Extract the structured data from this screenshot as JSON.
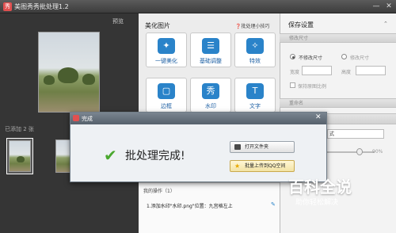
{
  "window": {
    "title": "美图秀秀批处理1.2",
    "icon_glyph": "秀",
    "controls": [
      "—",
      "✕"
    ]
  },
  "left": {
    "preview_label": "预览",
    "added_count": "已添加 2 张"
  },
  "middle": {
    "section_title": "美化图片",
    "tips": "批处理小技巧",
    "tools": [
      {
        "label": "一键美化",
        "glyph": "✦"
      },
      {
        "label": "基础调整",
        "glyph": "☰"
      },
      {
        "label": "特效",
        "glyph": "✧"
      },
      {
        "label": "边框",
        "glyph": "▢"
      },
      {
        "label": "水印",
        "glyph": "秀"
      },
      {
        "label": "文字",
        "glyph": "T"
      }
    ],
    "ops_title": "我的操作（1）",
    "ops_item": "1.添加水印\"水印.png\"位置：九宫格左上"
  },
  "right": {
    "title": "保存设置",
    "resize_header": "修改尺寸",
    "opt_keep": "不修改尺寸",
    "opt_change": "修改尺寸",
    "width_label": "宽度",
    "height_label": "高度",
    "keep_ratio": "保持原图比例",
    "rename_header": "重命名",
    "format_value": "式",
    "quality_value": "90%"
  },
  "dialog": {
    "title": "完成",
    "message": "批处理完成!",
    "btn_open": "打开文件夹",
    "btn_upload": "批量上传到QQ空间"
  },
  "watermark": {
    "big": "百科全说",
    "small": "助你轻松解决"
  },
  "colors": {
    "accent": "#2a83c9",
    "check": "#4aa82e"
  }
}
